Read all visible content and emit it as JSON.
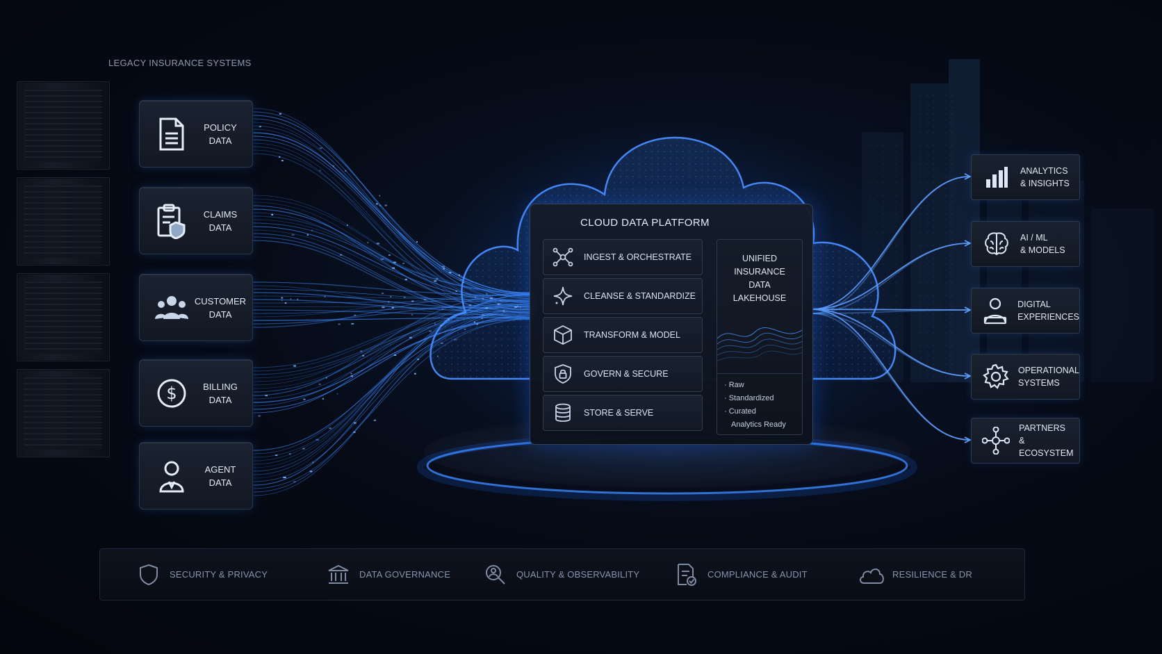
{
  "section_label": "LEGACY INSURANCE SYSTEMS",
  "sources": [
    {
      "label_1": "POLICY",
      "label_2": "DATA",
      "icon": "document-icon"
    },
    {
      "label_1": "CLAIMS",
      "label_2": "DATA",
      "icon": "clipboard-shield-icon"
    },
    {
      "label_1": "CUSTOMER",
      "label_2": "DATA",
      "icon": "people-icon"
    },
    {
      "label_1": "BILLING",
      "label_2": "DATA",
      "icon": "dollar-icon"
    },
    {
      "label_1": "AGENT",
      "label_2": "DATA",
      "icon": "person-icon"
    }
  ],
  "platform": {
    "title": "CLOUD DATA PLATFORM",
    "steps": [
      {
        "label": "INGEST & ORCHESTRATE",
        "icon": "network-nodes-icon"
      },
      {
        "label": "CLEANSE & STANDARDIZE",
        "icon": "sparkle-icon"
      },
      {
        "label": "TRANSFORM & MODEL",
        "icon": "cube-icon"
      },
      {
        "label": "GOVERN & SECURE",
        "icon": "shield-lock-icon"
      },
      {
        "label": "STORE & SERVE",
        "icon": "database-icon"
      }
    ],
    "lakehouse": {
      "title_1": "UNIFIED",
      "title_2": "INSURANCE",
      "title_3": "DATA LAKEHOUSE",
      "layers": [
        "· Raw",
        "· Standardized",
        "· Curated",
        "Analytics Ready"
      ]
    }
  },
  "outputs": [
    {
      "label_1": "ANALYTICS",
      "label_2": "& INSIGHTS",
      "icon": "bar-chart-icon"
    },
    {
      "label_1": "AI / ML",
      "label_2": "& MODELS",
      "icon": "brain-icon"
    },
    {
      "label_1": "DIGITAL",
      "label_2": "EXPERIENCES",
      "icon": "user-device-icon"
    },
    {
      "label_1": "OPERATIONAL",
      "label_2": "SYSTEMS",
      "icon": "gear-icon"
    },
    {
      "label_1": "PARTNERS",
      "label_2": "& ECOSYSTEM",
      "icon": "hub-icon"
    }
  ],
  "pillars": [
    {
      "label": "SECURITY & PRIVACY",
      "icon": "shield-icon"
    },
    {
      "label": "DATA GOVERNANCE",
      "icon": "bank-icon"
    },
    {
      "label": "QUALITY & OBSERVABILITY",
      "icon": "search-person-icon"
    },
    {
      "label": "COMPLIANCE & AUDIT",
      "icon": "document-check-icon"
    },
    {
      "label": "RESILIENCE & DR",
      "icon": "cloud-icon"
    }
  ],
  "colors": {
    "accent": "#3d8bff",
    "glow": "#1f6fff",
    "text": "#e2e9f5",
    "muted": "#8896ad"
  }
}
